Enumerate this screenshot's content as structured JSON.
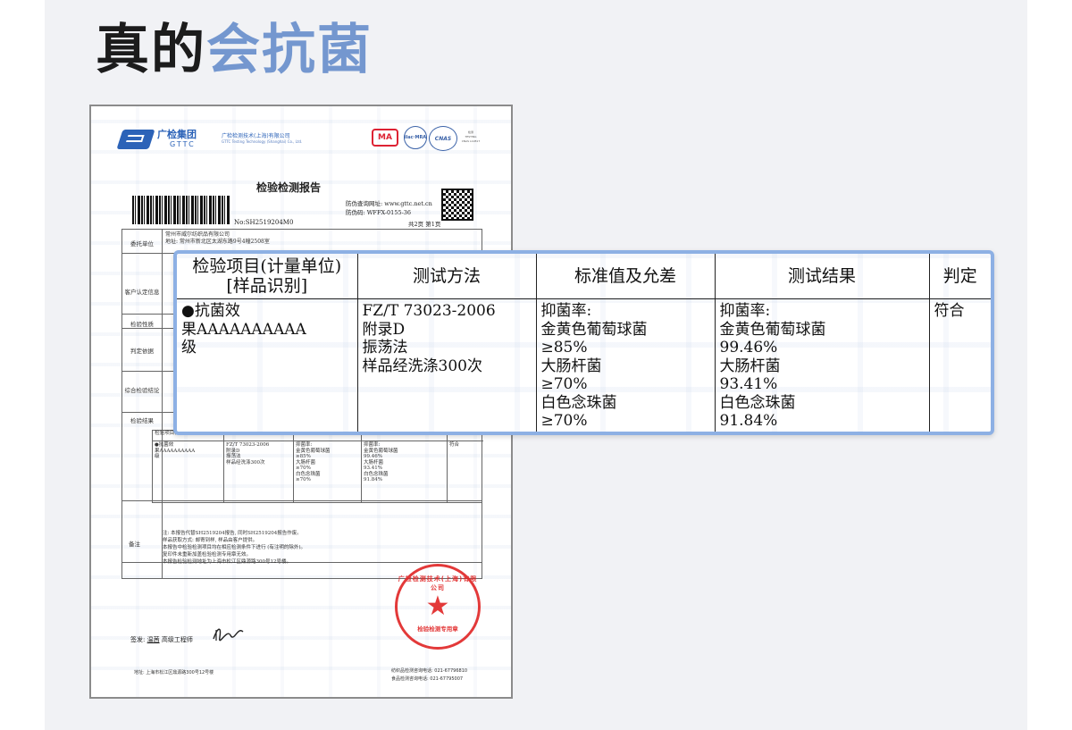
{
  "headline": {
    "part1": "真的",
    "part2": "会抗菌"
  },
  "report": {
    "group_name": "广检集团",
    "group_abbr": "GTTC",
    "company": "广检检测技术(上海)有限公司",
    "company_en": "GTTC Testing Technology (Shanghai) Co., Ltd.",
    "cert_ma": "MA",
    "cert_ilac": "ilac·MRA",
    "cert_cnas": "CNAS",
    "cert_testing": [
      "检测",
      "TESTING",
      "CNAS L12817"
    ],
    "title": "检验检测报告",
    "verify_site": "防伪查询网址: www.gttc.net.cn",
    "verify_code": "防伪码: WFFX-0155-36",
    "report_no": "No:SH2519204M0",
    "page_no": "共2页 第1页",
    "row_labels": [
      "委托单位",
      "客户认定信息",
      "检验性质",
      "判定依据",
      "综合检验结论",
      "检验结果"
    ],
    "client_name": "常州市威尔纺织品有限公司",
    "client_address": "地址: 常州市新北区太湖东路9号4幢2508室",
    "mini_headers": [
      "检验项目(计量单位)[样品识别]",
      "测试方法",
      "标准值及允差",
      "测试结果",
      "判定"
    ],
    "notes_label": "备注",
    "notes": [
      "注: 本报告代替SH2519204报告, 同时SH2519204报告作废。",
      "样品获取方式: 邮寄到样, 样品由客户提供。",
      "本报告中检验检测项目均在相应检测条件下进行 (有注明的除外)。",
      "复印件未重新加盖检验检测专用章无效。",
      "本报告检验检测地址为上海市松江区鼎源路300号12号楼。"
    ],
    "seal_arc": "广检检测技术(上海)有限公司",
    "seal_text": "检验检测专用章",
    "signer_label": "签发:",
    "signer_name": "温茜",
    "signer_title": "高级工程师",
    "footer_address": "地址: 上海市松江区鼎源路300号12号楼",
    "footer_phone1": "纺织品检测咨询电话: 021-67796810",
    "footer_phone2": "食品检测咨询电话: 021-67795007"
  },
  "result_table": {
    "headers": {
      "item": [
        "检验项目(计量单位)",
        "[样品识别]"
      ],
      "method": "测试方法",
      "standard": "标准值及允差",
      "result": "测试结果",
      "judgement": "判定"
    },
    "row": {
      "item": [
        "●抗菌效",
        "果AAAAAAAAAA",
        "级"
      ],
      "method": [
        "FZ/T 73023-2006",
        "附录D",
        "振荡法",
        "样品经洗涤300次"
      ],
      "standard": [
        "抑菌率:",
        "金黄色葡萄球菌",
        "≥85%",
        "大肠杆菌",
        "≥70%",
        "白色念珠菌",
        "≥70%"
      ],
      "result": [
        "抑菌率:",
        "金黄色葡萄球菌",
        "99.46%",
        "大肠杆菌",
        "93.41%",
        "白色念珠菌",
        "91.84%"
      ],
      "judgement": "符合"
    }
  },
  "colors": {
    "accent": "#7497cf",
    "zoom_border": "#8db0e4",
    "seal": "#e02424",
    "brand": "#2c63b8"
  }
}
